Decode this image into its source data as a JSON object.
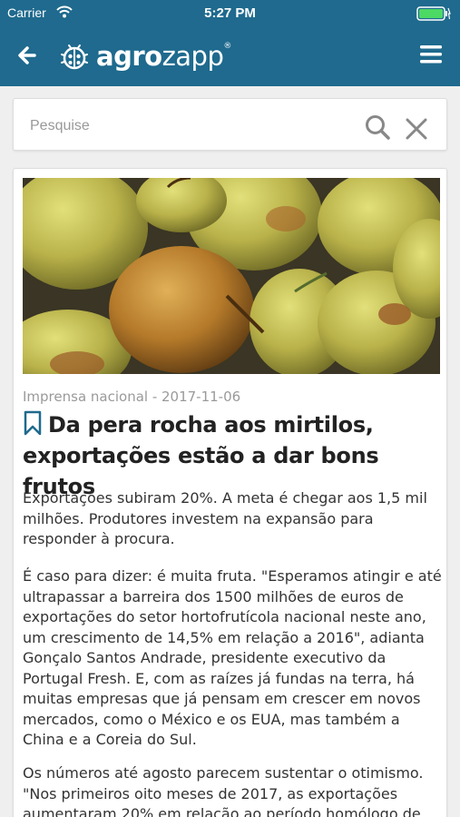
{
  "status_bar": {
    "carrier": "Carrier",
    "time": "5:27 PM"
  },
  "header": {
    "logo_bold": "agro",
    "logo_light": "zapp",
    "logo_mark": "®",
    "background": "#1f6a8e"
  },
  "search": {
    "placeholder": "Pesquise",
    "value": ""
  },
  "article": {
    "source": "Imprensa nacional - 2017-11-06",
    "title": "Da pera rocha aos mirtilos, exportações estão a dar bons frutos",
    "paragraphs": [
      "Exportações subiram 20%. A meta é chegar aos 1,5 mil milhões. Produtores investem na expansão para responder à procura.",
      "É caso para dizer: é muita fruta. \"Esperamos atingir e até ultrapassar a barreira dos 1500 milhões de euros de exportações do setor hortofrutícola nacional neste ano, um crescimento de 14,5% em relação a 2016\", adianta Gonçalo Santos Andrade, presidente executivo da Portugal Fresh. E, com as raízes já fundas na terra, há muitas empresas que já pensam em crescer em novos mercados, como o México e os EUA, mas também a China e a Coreia do Sul.",
      "Os números até agosto parecem sustentar o otimismo. \"Nos primeiros oito meses de 2017, as exportações aumentaram 20% em relação ao período homólogo de"
    ]
  },
  "icons": {
    "back": "arrow-left-icon",
    "menu": "hamburger-menu-icon",
    "search": "search-icon",
    "clear": "close-icon",
    "bookmark": "bookmark-icon"
  }
}
